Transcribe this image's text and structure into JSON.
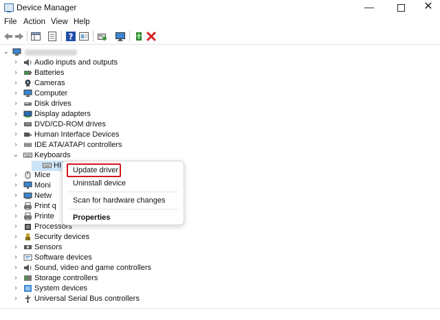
{
  "window": {
    "title": "Device Manager",
    "controls": {
      "minimize": "—",
      "close": "✕"
    }
  },
  "menu": [
    "File",
    "Action",
    "View",
    "Help"
  ],
  "toolbar_icons": [
    "back-icon",
    "forward-icon",
    "show-hide-tree-icon",
    "properties-icon",
    "help-icon",
    "show-hidden-icon",
    "scan-hardware-icon",
    "monitor-icon",
    "update-driver-icon",
    "uninstall-icon"
  ],
  "tree": {
    "expanded": "Keyboards",
    "selected_child": "HI",
    "categories": [
      {
        "label": "Audio inputs and outputs",
        "icon": "speaker-icon"
      },
      {
        "label": "Batteries",
        "icon": "battery-icon"
      },
      {
        "label": "Cameras",
        "icon": "camera-icon"
      },
      {
        "label": "Computer",
        "icon": "computer-icon"
      },
      {
        "label": "Disk drives",
        "icon": "disk-icon"
      },
      {
        "label": "Display adapters",
        "icon": "display-icon"
      },
      {
        "label": "DVD/CD-ROM drives",
        "icon": "dvd-icon"
      },
      {
        "label": "Human Interface Devices",
        "icon": "hid-icon"
      },
      {
        "label": "IDE ATA/ATAPI controllers",
        "icon": "ide-icon"
      },
      {
        "label": "Keyboards",
        "icon": "keyboard-icon"
      },
      {
        "label": "HI",
        "icon": "keyboard-icon"
      },
      {
        "label": "Mice",
        "icon": "mouse-icon"
      },
      {
        "label": "Moni",
        "icon": "monitor-icon"
      },
      {
        "label": "Netw",
        "icon": "network-icon"
      },
      {
        "label": "Print q",
        "icon": "printer-icon"
      },
      {
        "label": "Printe",
        "icon": "printer-icon"
      },
      {
        "label": "Processors",
        "icon": "processor-icon"
      },
      {
        "label": "Security devices",
        "icon": "security-icon"
      },
      {
        "label": "Sensors",
        "icon": "sensor-icon"
      },
      {
        "label": "Software devices",
        "icon": "software-icon"
      },
      {
        "label": "Sound, video and game controllers",
        "icon": "sound-icon"
      },
      {
        "label": "Storage controllers",
        "icon": "storage-icon"
      },
      {
        "label": "System devices",
        "icon": "system-icon"
      },
      {
        "label": "Universal Serial Bus controllers",
        "icon": "usb-icon"
      }
    ]
  },
  "context_menu": {
    "items": [
      "Update driver",
      "Uninstall device",
      "Scan for hardware changes",
      "Properties"
    ],
    "highlighted": "Update driver",
    "highlight_color": "#d4141a"
  },
  "colors": {
    "selection": "#cce4f7",
    "accent": "#1f6fbf"
  }
}
